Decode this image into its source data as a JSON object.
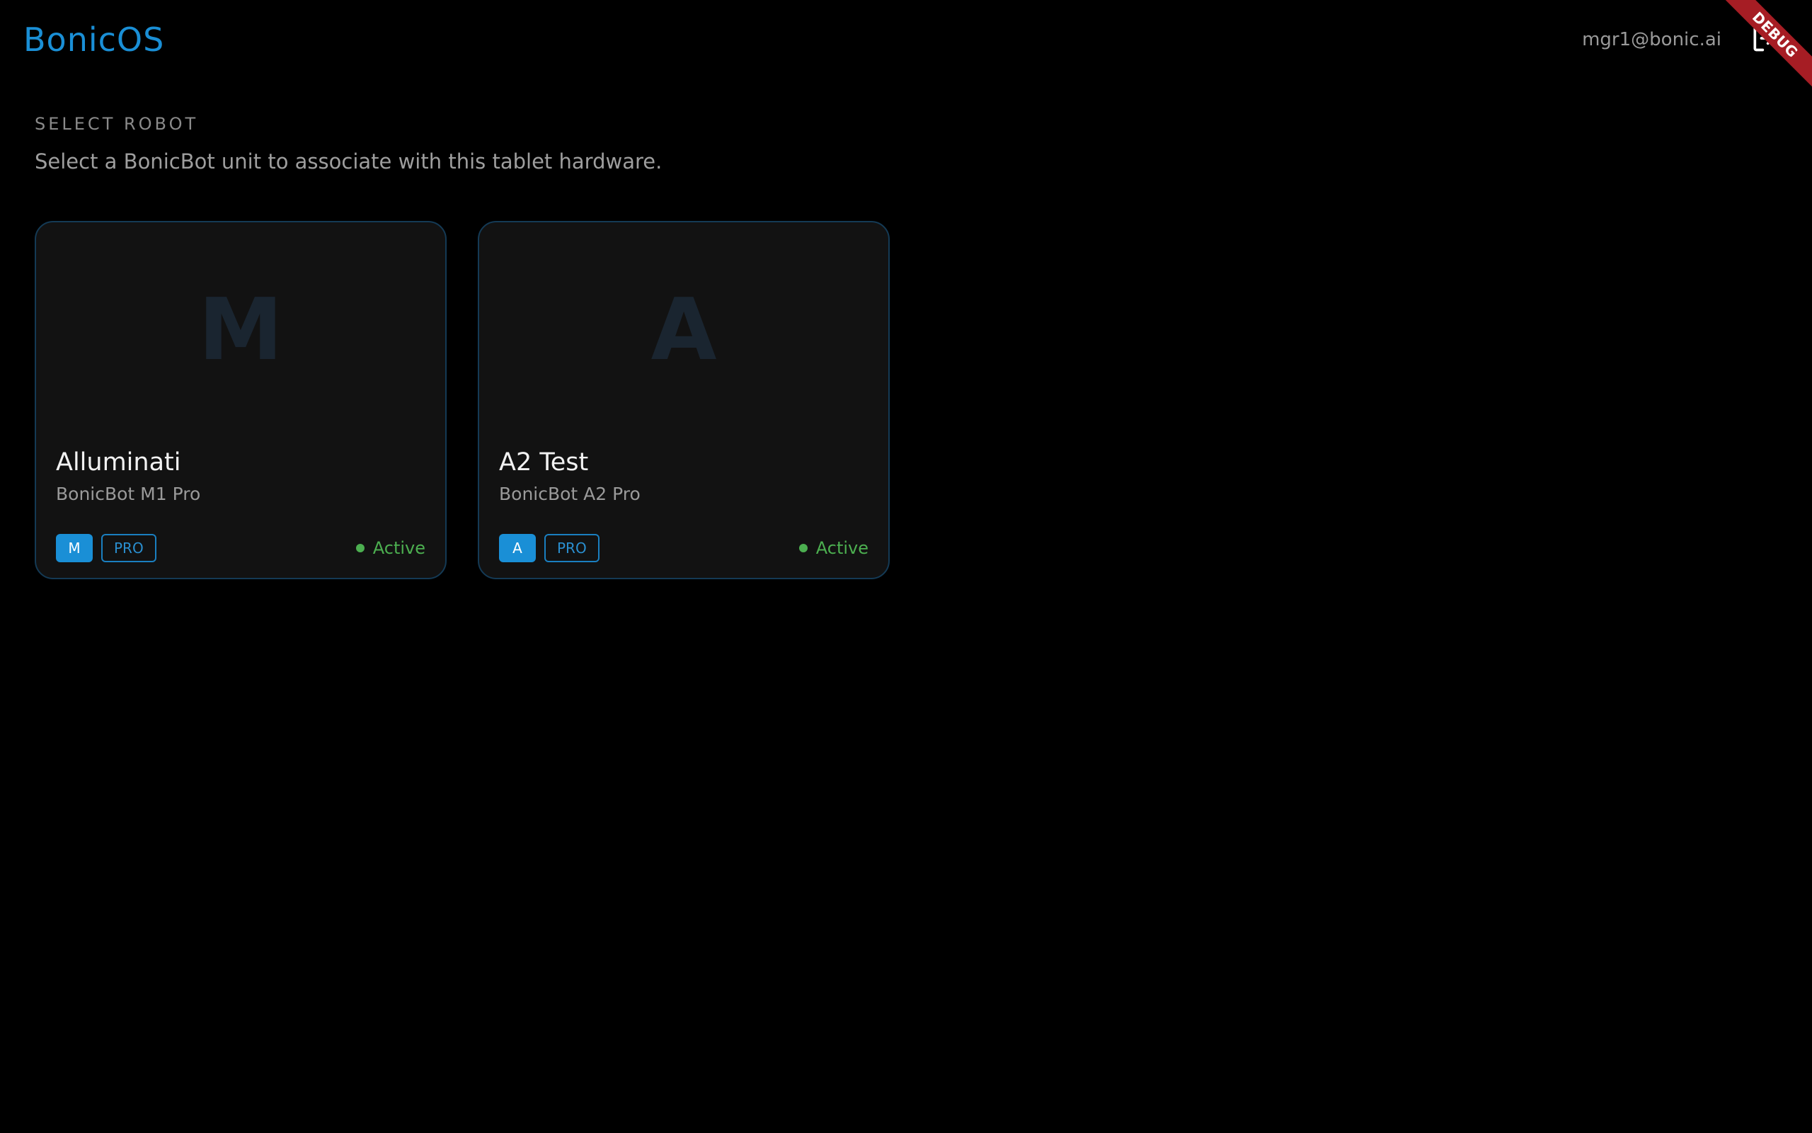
{
  "header": {
    "brand": "BonicOS",
    "user_email": "mgr1@bonic.ai",
    "logout_icon": "logout-icon"
  },
  "debug_banner": "DEBUG",
  "page": {
    "section_label": "SELECT ROBOT",
    "description": "Select a BonicBot unit to associate with this tablet hardware."
  },
  "robots": [
    {
      "initial": "M",
      "name": "Alluminati",
      "model": "BonicBot M1 Pro",
      "badge_letter": "M",
      "badge_tier": "PRO",
      "status": "Active"
    },
    {
      "initial": "A",
      "name": "A2 Test",
      "model": "BonicBot A2 Pro",
      "badge_letter": "A",
      "badge_tier": "PRO",
      "status": "Active"
    }
  ],
  "colors": {
    "brand": "#1a8fd6",
    "active": "#4caf50",
    "card_border": "#143a55",
    "debug": "#a61d24"
  }
}
